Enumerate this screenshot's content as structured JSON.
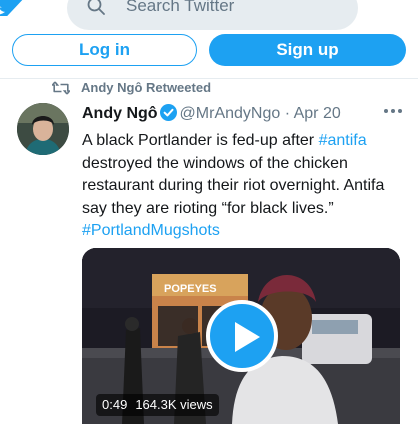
{
  "header": {
    "search": {
      "placeholder": "Search Twitter"
    }
  },
  "auth": {
    "login_label": "Log in",
    "signup_label": "Sign up"
  },
  "tweet": {
    "retweet_label": "Andy Ngô Retweeted",
    "author_name": "Andy Ngô",
    "handle": "@MrAndyNgo",
    "separator": " · ",
    "date": "Apr 20",
    "text_parts": {
      "a": "A black Portlander is fed-up after ",
      "hashtag1": "#antifa",
      "b": " destroyed the windows of the chicken restaurant during their riot overnight. Antifa say they are rioting “for black lives.” ",
      "hashtag2": "#PortlandMugshots"
    },
    "video": {
      "duration": "0:49",
      "views": "164.3K views",
      "sign_text": "POPEYES"
    }
  },
  "colors": {
    "accent": "#1da1f2",
    "secondary_text": "#657786",
    "divider": "#e6ecf0"
  }
}
